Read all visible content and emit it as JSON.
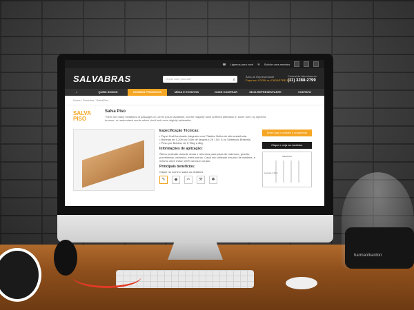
{
  "scene": {
    "speaker_brand": "harman/kardon"
  },
  "site": {
    "topbar": {
      "link_store": "Ligamos para você",
      "link_sample": "Solicite uma amostra"
    },
    "logo": "SALVABRAS",
    "search_placeholder": "O que você procura?",
    "rep": {
      "title": "Área de Representante",
      "text": "Faça seu LOGIN ou CADASTRE-SE"
    },
    "support": {
      "title": "Central de Atendimento",
      "phone": "(11) 3288-2799"
    },
    "nav": [
      "QUEM SOMOS",
      "NOSSOS PRODUTOS",
      "MÍDIA E EVENTOS",
      "ONDE COMPRAR",
      "SEJA REPRESENTANTE",
      "CONTATO"
    ],
    "nav_active_index": 1,
    "breadcrumb": "Home  /  Produtos  /  SalvaPiso",
    "product": {
      "brand_logo_line1": "SALVA",
      "brand_logo_line2": "PISO",
      "title": "Salva Piso",
      "description": "There are many variations of passages of Lorem Ipsum available, but the majority have suffered alteration in some form, by injected humour, or randomised words which don't look even slightly believable.",
      "specs_title": "Especificação Técnicas:",
      "specs": [
        "• Papel Kraft laminado integrado com Plástico Bolha de alta resistência.",
        "• Bobinas de 1,20m ou 0,6m de largura x 25 / 15 / 8 ou Sinteticas Bresesis.",
        "• Peso por Bobina: de 5,76kg a 8kg."
      ],
      "usage_title": "Informações de aplicação:",
      "usage": "Ótima proteção durante obras e reformas para pisos de mármore, granito, porcelanato, cerâmico, entre outros. Cada rolo utilizado em piso de madeira, e mesmo deve evitar 100% secos e curado.",
      "benefits_title": "Principais benefícios:",
      "benefits_hint": "Clique no ícone e saiba os detalhes",
      "cta_quote": "Entre aqui e solicite o orçamento",
      "cta_measure": "Clique e veja as medidas.",
      "measure_title": "MEDIDAS",
      "measure_row": "Largura 1,20m"
    }
  }
}
